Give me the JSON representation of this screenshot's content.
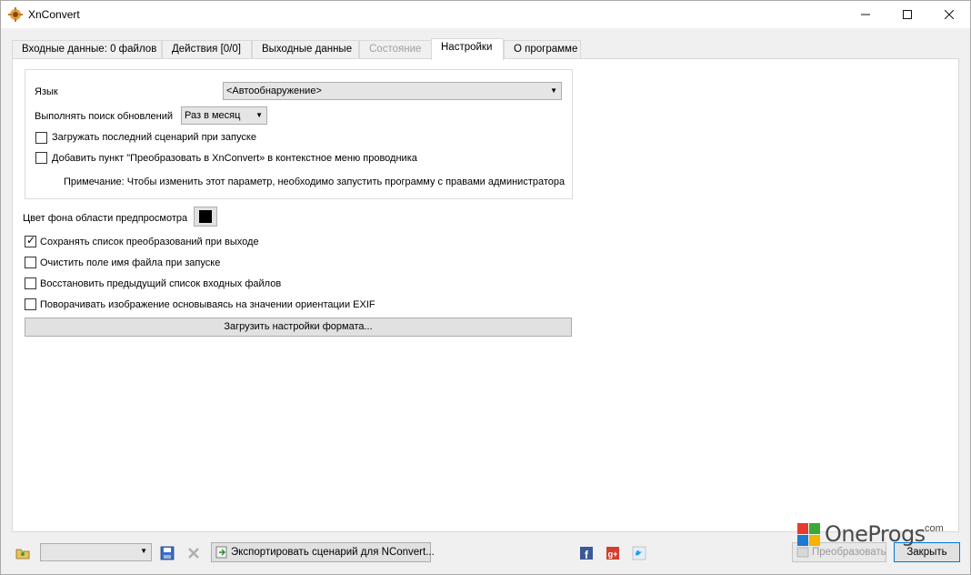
{
  "window": {
    "title": "XnConvert"
  },
  "tabs": [
    {
      "label": "Входные данные: 0 файлов"
    },
    {
      "label": "Действия [0/0]"
    },
    {
      "label": "Выходные данные"
    },
    {
      "label": "Состояние"
    },
    {
      "label": "Настройки"
    },
    {
      "label": "О программе"
    }
  ],
  "settings": {
    "language_label": "Язык",
    "language_value": "<Автообнаружение>",
    "update_label": "Выполнять поиск обновлений",
    "update_value": "Раз в месяц",
    "load_last_script_label": "Загружать последний сценарий при запуске",
    "load_last_script_checked": false,
    "context_menu_label": "Добавить пункт \"Преобразовать в XnConvert» в контекстное меню проводника",
    "context_menu_checked": false,
    "note": "Примечание: Чтобы изменить этот параметр, необходимо запустить программу с правами администратора",
    "preview_bg_label": "Цвет фона области предпросмотра",
    "preview_bg_color": "#000000",
    "save_list_label": "Сохранять список преобразований при выходе",
    "save_list_checked": true,
    "clear_filename_label": "Очистить поле имя файла при запуске",
    "clear_filename_checked": false,
    "restore_inputs_label": "Восстановить предыдущий список входных файлов",
    "restore_inputs_checked": false,
    "exif_rotate_label": "Поворачивать изображение основываясь на значении ориентации EXIF",
    "exif_rotate_checked": false,
    "load_format_button": "Загрузить настройки формата..."
  },
  "bottom": {
    "export_button": "Экспортировать сценарий для NConvert...",
    "convert_button": "Преобразовать",
    "close_button": "Закрыть"
  },
  "watermark": {
    "text": "OneProgs",
    "suffix": ".com"
  },
  "colors": {
    "accent": "#0078d7",
    "panel_bg": "#ffffff",
    "window_bg": "#f0f0f0"
  }
}
